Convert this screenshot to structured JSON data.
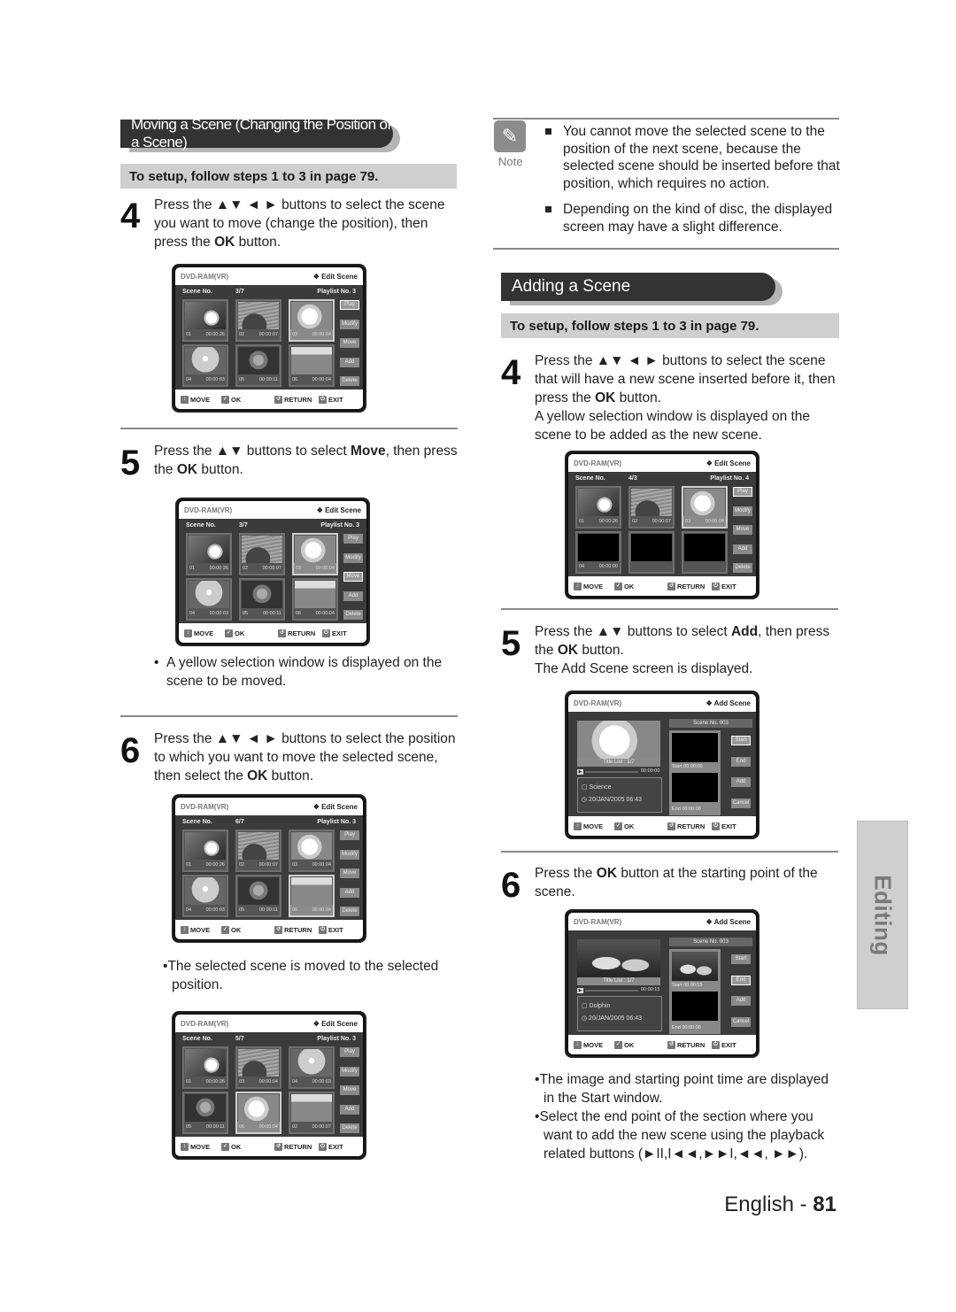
{
  "moving": {
    "title": "Moving a Scene (Changing the Position of a Scene)",
    "setup": "To setup, follow steps 1 to 3 in page 79.",
    "step4": {
      "num": "4",
      "pre": "Press the ▲▼ ◄ ► buttons to select the scene you want to move (change the position), then press the ",
      "bold": "OK",
      "post": " button."
    },
    "step5": {
      "num": "5",
      "pre": "Press the ▲▼ buttons to select ",
      "bold1": "Move",
      "mid": ", then press the ",
      "bold2": "OK",
      "post": " button."
    },
    "step5_bullet": "A yellow selection window is displayed on the scene to be moved.",
    "step6": {
      "num": "6",
      "pre": "Press the ▲▼ ◄ ► buttons to select the position to which you want to move the selected scene, then select the ",
      "bold": "OK",
      "post": " button."
    },
    "step6_bullet": "The selected scene is moved to the selected position."
  },
  "note": {
    "label": "Note",
    "icon": "pencil-icon",
    "items": [
      "You cannot move the selected scene to the position of the next scene, because the selected scene should be inserted before that position, which requires no action.",
      "Depending on the kind of disc, the displayed screen may have a slight difference."
    ]
  },
  "adding": {
    "title": "Adding a Scene",
    "setup": "To setup, follow steps 1 to 3 in page 79.",
    "step4": {
      "num": "4",
      "pre": "Press the ▲▼ ◄ ► buttons to select the scene that will have a new scene inserted before it, then press the ",
      "bold": "OK",
      "post": " button.",
      "extra": "A yellow selection window is displayed on the scene to be added as the new scene."
    },
    "step5": {
      "num": "5",
      "pre": "Press the ▲▼ buttons to select ",
      "bold1": "Add",
      "mid": ", then press the ",
      "bold2": "OK",
      "post": " button.",
      "extra": "The Add Scene screen is displayed."
    },
    "step6": {
      "num": "6",
      "pre": "Press the ",
      "bold": "OK",
      "post": " button at the starting point of the scene."
    },
    "bullets": [
      "The image and starting point time are displayed in the Start window.",
      "Select the end point of the section where you want to add the new scene using the playback related buttons (►II,I◄◄,►►I,◄◄, ►►)."
    ]
  },
  "osd_common": {
    "disc": "DVD-RAM(VR)",
    "edit_title": "❖ Edit Scene",
    "add_title": "❖ Add Scene",
    "scene_no_label": "Scene No.",
    "playlist_label": "Playlist No.",
    "side_buttons": [
      "Play",
      "Modify",
      "Move",
      "Add",
      "Delete"
    ],
    "add_buttons": [
      "Start",
      "End",
      "Add",
      "Cancel"
    ],
    "footer": {
      "move": "MOVE",
      "ok": "OK",
      "return": "RETURN",
      "exit": "EXIT"
    }
  },
  "screens": {
    "s1": {
      "scene": "3/7",
      "playlist": "3",
      "active_btn": 0,
      "selected": 2,
      "thumbs": [
        [
          "01",
          "00:00:26",
          "flower"
        ],
        [
          "02",
          "00:00:07",
          "dolphin"
        ],
        [
          "03",
          "00:00:04",
          "lily"
        ],
        [
          "04",
          "00:00:03",
          "daisy"
        ],
        [
          "05",
          "00:00:11",
          "roses"
        ],
        [
          "06",
          "00:00:04",
          "field"
        ]
      ]
    },
    "s2": {
      "scene": "3/7",
      "playlist": "3",
      "active_btn": 2,
      "selected": 2,
      "thumbs": [
        [
          "01",
          "00:00:26",
          "flower"
        ],
        [
          "02",
          "00:00:07",
          "dolphin"
        ],
        [
          "03",
          "00:00:04",
          "lily"
        ],
        [
          "04",
          "00:00:03",
          "daisy"
        ],
        [
          "05",
          "00:00:11",
          "roses"
        ],
        [
          "06",
          "00:00:04",
          "field"
        ]
      ]
    },
    "s3": {
      "scene": "6/7",
      "playlist": "3",
      "active_btn": -1,
      "selected": 5,
      "thumbs": [
        [
          "01",
          "00:00:26",
          "flower"
        ],
        [
          "02",
          "00:00:07",
          "dolphin"
        ],
        [
          "03",
          "00:00:04",
          "lily"
        ],
        [
          "04",
          "00:00:03",
          "daisy"
        ],
        [
          "05",
          "00:00:11",
          "roses"
        ],
        [
          "06",
          "00:00:04",
          "field"
        ]
      ]
    },
    "s4": {
      "scene": "5/7",
      "playlist": "3",
      "active_btn": -1,
      "selected": 4,
      "thumbs": [
        [
          "01",
          "00:00:26",
          "flower"
        ],
        [
          "03",
          "00:00:04",
          "dolphin"
        ],
        [
          "04",
          "00:00:03",
          "daisy"
        ],
        [
          "05",
          "00:00:11",
          "roses"
        ],
        [
          "06",
          "00:00:04",
          "lily"
        ],
        [
          "02",
          "00:00:07",
          "field"
        ]
      ]
    },
    "s5": {
      "scene": "4/3",
      "playlist": "4",
      "active_btn": 0,
      "selected": 2,
      "thumbs": [
        [
          "01",
          "00:00:26",
          "flower"
        ],
        [
          "02",
          "00:00:07",
          "dolphin"
        ],
        [
          "03",
          "00:00:04",
          "lily"
        ],
        [
          "04",
          "00:00:00",
          "black"
        ],
        [
          "",
          "",
          "black"
        ],
        [
          "",
          "",
          "black"
        ]
      ]
    },
    "a1": {
      "scene_no": "Scene No. 003",
      "title_list": "Title List : 1/7",
      "time": "00:00:00",
      "name": "Science",
      "date": "20/JAN/2005 06:43",
      "start_label": "Start",
      "start_time": "00:00:00",
      "end_label": "End",
      "end_time": "00:00:00",
      "active_btn": 0,
      "preview": "lily",
      "start_img": "black"
    },
    "a2": {
      "scene_no": "Scene No. 003",
      "title_list": "Title List : 1/7",
      "time": "00:00:15",
      "name": "Dolphin",
      "date": "20/JAN/2005 06:43",
      "start_label": "Start",
      "start_time": "00:00:15",
      "end_label": "End",
      "end_time": "00:00:00",
      "active_btn": 1,
      "preview": "otters",
      "start_img": "otters"
    }
  },
  "side_tab": "Editing",
  "footer": {
    "lang": "English - ",
    "page": "81"
  }
}
